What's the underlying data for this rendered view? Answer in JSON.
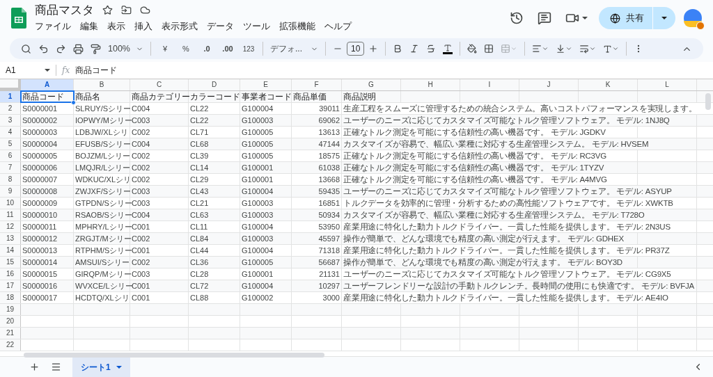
{
  "document": {
    "title": "商品マスタ"
  },
  "menu": [
    "ファイル",
    "編集",
    "表示",
    "挿入",
    "表示形式",
    "データ",
    "ツール",
    "拡張機能",
    "ヘルプ"
  ],
  "share_button": {
    "label": "共有"
  },
  "toolbar": {
    "zoom": "100%",
    "currency": "¥",
    "percent": "%",
    "decrease_decimal": ".0",
    "increase_decimal": ".00",
    "number_format": "123",
    "font": "デフォ...",
    "font_size": "10",
    "merge": {
      "disabled": true
    }
  },
  "formula_bar": {
    "cell_ref": "A1",
    "fx_label": "fx",
    "formula": "商品コード"
  },
  "columns": [
    {
      "label": "A",
      "selected": true
    },
    {
      "label": "B",
      "selected": false
    },
    {
      "label": "C",
      "selected": false
    },
    {
      "label": "D",
      "selected": false
    },
    {
      "label": "E",
      "selected": false
    },
    {
      "label": "F",
      "selected": false
    },
    {
      "label": "G",
      "selected": false
    },
    {
      "label": "H",
      "selected": false
    },
    {
      "label": "I",
      "selected": false
    },
    {
      "label": "J",
      "selected": false
    },
    {
      "label": "K",
      "selected": false
    },
    {
      "label": "L",
      "selected": false
    }
  ],
  "rows": [
    {
      "number": "1",
      "selected": true,
      "cells": [
        "商品コード",
        "商品名",
        "商品カテゴリー",
        "カラーコード",
        "事業者コード",
        "商品単価",
        "商品説明"
      ]
    },
    {
      "number": "2",
      "selected": false,
      "cells": [
        "S0000001",
        "SLRUY/Sシリー",
        "C004",
        "CL22",
        "G100004",
        "39011",
        "生産工程をスムーズに管理するための統合システム。高いコストパフォーマンスを実現します。"
      ]
    },
    {
      "number": "3",
      "selected": false,
      "cells": [
        "S0000002",
        "IOPWY/Mシリー",
        "C003",
        "CL22",
        "G100003",
        "69062",
        "ユーザーのニーズに応じてカスタマイズ可能なトルク管理ソフトウェア。 モデル: 1NJ8Q"
      ]
    },
    {
      "number": "4",
      "selected": false,
      "cells": [
        "S0000003",
        "LDBJW/XLシリ",
        "C002",
        "CL71",
        "G100005",
        "13613",
        "正確なトルク測定を可能にする信頼性の高い機器です。 モデル: JGDKV"
      ]
    },
    {
      "number": "5",
      "selected": false,
      "cells": [
        "S0000004",
        "EFUSB/Sシリー",
        "C004",
        "CL68",
        "G100005",
        "47144",
        "カスタマイズが容易で、幅広い業種に対応する生産管理システム。 モデル: HVSEM"
      ]
    },
    {
      "number": "6",
      "selected": false,
      "cells": [
        "S0000005",
        "BOJZM/Lシリー",
        "C002",
        "CL39",
        "G100005",
        "18575",
        "正確なトルク測定を可能にする信頼性の高い機器です。 モデル: RC3VG"
      ]
    },
    {
      "number": "7",
      "selected": false,
      "cells": [
        "S0000006",
        "LMQJR/Lシリー",
        "C002",
        "CL14",
        "G100001",
        "61038",
        "正確なトルク測定を可能にする信頼性の高い機器です。 モデル: 1TYZV"
      ]
    },
    {
      "number": "8",
      "selected": false,
      "cells": [
        "S0000007",
        "WDKUC/XLシリ",
        "C002",
        "CL29",
        "G100001",
        "13668",
        "正確なトルク測定を可能にする信頼性の高い機器です。 モデル: A4MVG"
      ]
    },
    {
      "number": "9",
      "selected": false,
      "cells": [
        "S0000008",
        "ZWJXF/Sシリー",
        "C003",
        "CL43",
        "G100004",
        "59435",
        "ユーザーのニーズに応じてカスタマイズ可能なトルク管理ソフトウェア。 モデル: ASYUP"
      ]
    },
    {
      "number": "10",
      "selected": false,
      "cells": [
        "S0000009",
        "GTPDN/Sシリー",
        "C003",
        "CL21",
        "G100003",
        "16851",
        "トルクデータを効率的に管理・分析するための高性能ソフトウェアです。 モデル: XWKTB"
      ]
    },
    {
      "number": "11",
      "selected": false,
      "cells": [
        "S0000010",
        "RSAOB/Sシリー",
        "C004",
        "CL63",
        "G100003",
        "50934",
        "カスタマイズが容易で、幅広い業種に対応する生産管理システム。 モデル: T728O"
      ]
    },
    {
      "number": "12",
      "selected": false,
      "cells": [
        "S0000011",
        "MPHRY/Lシリー",
        "C001",
        "CL11",
        "G100004",
        "53950",
        "産業用途に特化した動力トルクドライバー。一貫した性能を提供します。 モデル: 2N3US"
      ]
    },
    {
      "number": "13",
      "selected": false,
      "cells": [
        "S0000012",
        "ZRGJT/Mシリー",
        "C002",
        "CL84",
        "G100003",
        "45597",
        "操作が簡単で、どんな環境でも精度の高い測定が行えます。 モデル: GDHEX"
      ]
    },
    {
      "number": "14",
      "selected": false,
      "cells": [
        "S0000013",
        "RTPHM/Sシリー",
        "C001",
        "CL44",
        "G100004",
        "71318",
        "産業用途に特化した動力トルクドライバー。一貫した性能を提供します。 モデル: PR37Z"
      ]
    },
    {
      "number": "15",
      "selected": false,
      "cells": [
        "S0000014",
        "AMSUI/Sシリー",
        "C002",
        "CL36",
        "G100005",
        "56687",
        "操作が簡単で、どんな環境でも精度の高い測定が行えます。 モデル: BOY3D"
      ]
    },
    {
      "number": "16",
      "selected": false,
      "cells": [
        "S0000015",
        "GIRQP/Mシリー",
        "C003",
        "CL28",
        "G100001",
        "21131",
        "ユーザーのニーズに応じてカスタマイズ可能なトルク管理ソフトウェア。 モデル: CG9X5"
      ]
    },
    {
      "number": "17",
      "selected": false,
      "cells": [
        "S0000016",
        "WVXCE/Lシリー",
        "C001",
        "CL72",
        "G100004",
        "10297",
        "ユーザーフレンドリーな設計の手動トルクレンチ。長時間の使用にも快適です。 モデル: BVFJA"
      ]
    },
    {
      "number": "18",
      "selected": false,
      "cells": [
        "S0000017",
        "HCDTQ/XLシリ",
        "C001",
        "CL88",
        "G100002",
        "3000",
        "産業用途に特化した動力トルクドライバー。一貫した性能を提供します。 モデル: AE4IO"
      ]
    },
    {
      "number": "19",
      "selected": false
    },
    {
      "number": "20",
      "selected": false
    },
    {
      "number": "21",
      "selected": false
    },
    {
      "number": "22",
      "selected": false
    }
  ],
  "sheet_tabs": [
    {
      "label": "シート1",
      "selected": true
    }
  ]
}
